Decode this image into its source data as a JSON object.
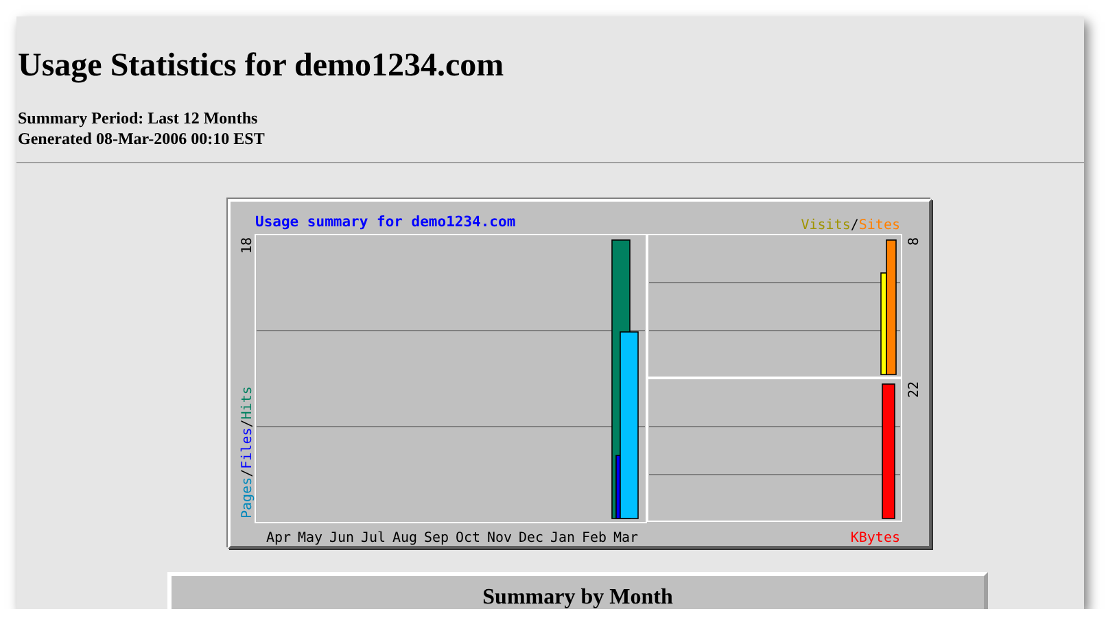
{
  "page": {
    "title": "Usage Statistics for demo1234.com",
    "summary_period": "Summary Period: Last 12 Months",
    "generated": "Generated 08-Mar-2006 00:10 EST"
  },
  "usage_graph": {
    "title": "Usage summary for demo1234.com",
    "left_legend": [
      {
        "text": "Pages",
        "color": "#0088bb"
      },
      {
        "text": "/",
        "color": "#000000"
      },
      {
        "text": "Files",
        "color": "#0000ff"
      },
      {
        "text": "/",
        "color": "#000000"
      },
      {
        "text": "Hits",
        "color": "#008060"
      }
    ],
    "left_max": "18",
    "right_legend": [
      {
        "text": "Visits",
        "color": "#a09400"
      },
      {
        "text": "/",
        "color": "#000000"
      },
      {
        "text": "Sites",
        "color": "#ff8000"
      }
    ],
    "top_right_max": "8",
    "bottom_right_max": "22",
    "bottom_right_label": "KBytes",
    "months": [
      "Apr",
      "May",
      "Jun",
      "Jul",
      "Aug",
      "Sep",
      "Oct",
      "Nov",
      "Dec",
      "Jan",
      "Feb",
      "Mar"
    ]
  },
  "summary_table": {
    "title": "Summary by Month"
  }
}
